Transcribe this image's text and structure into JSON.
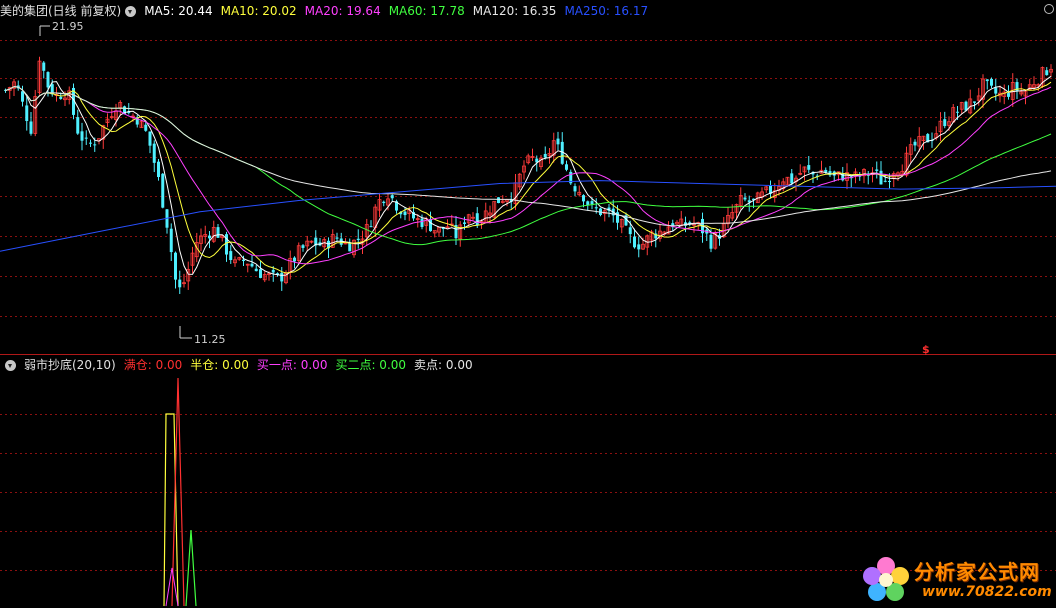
{
  "colors": {
    "up": "#ff3b3b",
    "down": "#4ff0ff",
    "ma5": "#ffffff",
    "ma10": "#ffff3c",
    "ma20": "#ff40ff",
    "ma60": "#40ff40",
    "ma120": "#e6e6e6",
    "ma250": "#2850ff",
    "grid": "#8b1010"
  },
  "price_panel": {
    "title": "美的集团(日线 前复权)",
    "ma": [
      {
        "label": "MA5: 20.44",
        "color": "#ffffff"
      },
      {
        "label": "MA10: 20.02",
        "color": "#ffff3c"
      },
      {
        "label": "MA20: 19.64",
        "color": "#ff40ff"
      },
      {
        "label": "MA60: 17.78",
        "color": "#40ff40"
      },
      {
        "label": "MA120: 16.35",
        "color": "#e6e6e6"
      },
      {
        "label": "MA250: 16.17",
        "color": "#2850ff"
      }
    ],
    "high_label": "21.95",
    "low_label": "11.25",
    "signal_mark": "$"
  },
  "indicator_panel": {
    "title": "弱市抄底(20,10)",
    "items": [
      {
        "label": "满仓: 0.00",
        "color": "#ff3030"
      },
      {
        "label": "半仓: 0.00",
        "color": "#ffff3c"
      },
      {
        "label": "买一点: 0.00",
        "color": "#ff40ff"
      },
      {
        "label": "买二点: 0.00",
        "color": "#40ff40"
      },
      {
        "label": "卖点: 0.00",
        "color": "#e6e6e6"
      }
    ]
  },
  "watermark": {
    "title": "分析家公式网",
    "url": "www.70822.com"
  },
  "chart_data": {
    "type": "candlestick",
    "title": "美的集团(日线 前复权)",
    "price_range": [
      11.25,
      21.95
    ],
    "series": [
      {
        "name": "MA5",
        "last": 20.44
      },
      {
        "name": "MA10",
        "last": 20.02
      },
      {
        "name": "MA20",
        "last": 19.64
      },
      {
        "name": "MA60",
        "last": 17.78
      },
      {
        "name": "MA120",
        "last": 16.35
      },
      {
        "name": "MA250",
        "last": 16.17
      }
    ],
    "indicator": {
      "name": "弱市抄底(20,10)",
      "lines": [
        "满仓",
        "半仓",
        "买一点",
        "买二点",
        "卖点"
      ]
    }
  }
}
